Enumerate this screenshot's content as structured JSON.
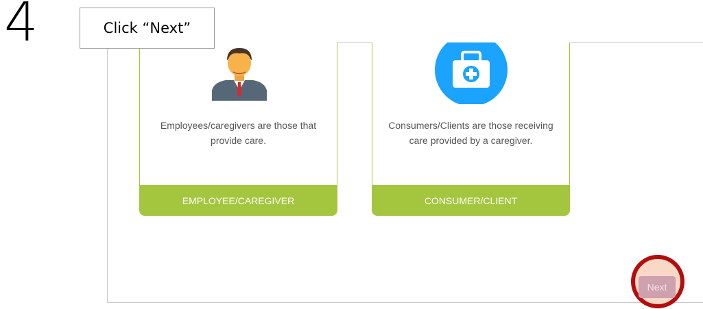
{
  "step": {
    "number": "4",
    "instruction": "Click “Next”"
  },
  "cards": [
    {
      "description": "Employees/caregivers are those that provide care.",
      "button_label": "EMPLOYEE/CAREGIVER",
      "icon": "employee-avatar-icon"
    },
    {
      "description": "Consumers/Clients are those receiving care provided by a caregiver.",
      "button_label": "CONSUMER/CLIENT",
      "icon": "medical-kit-icon"
    }
  ],
  "next_button": {
    "label": "Next"
  },
  "colors": {
    "accent_green": "#a4c63f",
    "medkit_blue": "#1aa3ff",
    "highlight_ring": "#b30d0d",
    "next_button_bg": "#cfa0ae"
  }
}
